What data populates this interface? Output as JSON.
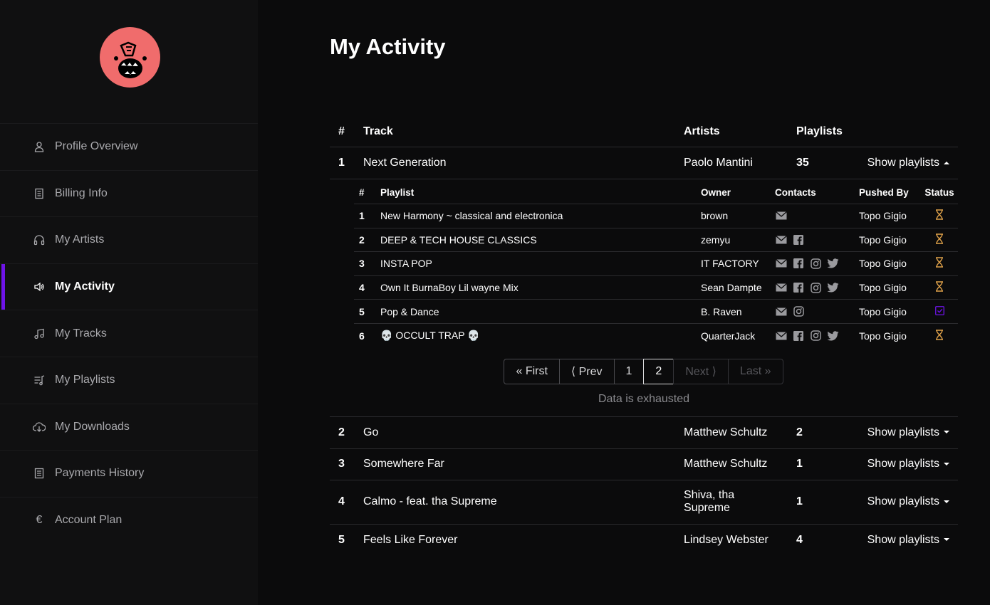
{
  "sidebar": {
    "items": [
      {
        "label": "Profile Overview",
        "icon": "user-icon"
      },
      {
        "label": "Billing Info",
        "icon": "document-icon"
      },
      {
        "label": "My Artists",
        "icon": "headphones-icon"
      },
      {
        "label": "My Activity",
        "icon": "speaker-icon",
        "active": true
      },
      {
        "label": "My Tracks",
        "icon": "music-note-icon"
      },
      {
        "label": "My Playlists",
        "icon": "playlist-icon"
      },
      {
        "label": "My Downloads",
        "icon": "cloud-download-icon"
      },
      {
        "label": "Payments History",
        "icon": "receipt-icon"
      },
      {
        "label": "Account Plan",
        "icon": "euro-icon"
      }
    ]
  },
  "page": {
    "title": "My Activity"
  },
  "table": {
    "headers": {
      "num": "#",
      "track": "Track",
      "artists": "Artists",
      "playlists": "Playlists"
    },
    "show_label": "Show playlists",
    "rows": [
      {
        "num": "1",
        "track": "Next Generation",
        "artist": "Paolo Mantini",
        "playlists": "35"
      },
      {
        "num": "2",
        "track": "Go",
        "artist": "Matthew Schultz",
        "playlists": "2"
      },
      {
        "num": "3",
        "track": "Somewhere Far",
        "artist": "Matthew Schultz",
        "playlists": "1"
      },
      {
        "num": "4",
        "track": "Calmo - feat. tha Supreme",
        "artist": "Shiva, tha Supreme",
        "playlists": "1"
      },
      {
        "num": "5",
        "track": "Feels Like Forever",
        "artist": "Lindsey Webster",
        "playlists": "4"
      }
    ]
  },
  "subtable": {
    "headers": {
      "num": "#",
      "playlist": "Playlist",
      "owner": "Owner",
      "contacts": "Contacts",
      "pushed_by": "Pushed By",
      "status": "Status"
    },
    "rows": [
      {
        "num": "1",
        "playlist": "New Harmony ~ classical and electronica",
        "owner": "brown",
        "pushed_by": "Topo Gigio"
      },
      {
        "num": "2",
        "playlist": "DEEP & TECH HOUSE CLASSICS",
        "owner": "zemyu",
        "pushed_by": "Topo Gigio"
      },
      {
        "num": "3",
        "playlist": "INSTA POP",
        "owner": "IT FACTORY",
        "pushed_by": "Topo Gigio"
      },
      {
        "num": "4",
        "playlist": "Own It BurnaBoy Lil wayne Mix",
        "owner": "Sean Dampte",
        "pushed_by": "Topo Gigio"
      },
      {
        "num": "5",
        "playlist": "Pop & Dance",
        "owner": "B. Raven",
        "pushed_by": "Topo Gigio"
      },
      {
        "num": "6",
        "playlist": "💀 OCCULT TRAP 💀",
        "owner": "QuarterJack",
        "pushed_by": "Topo Gigio"
      }
    ]
  },
  "pagination": {
    "first": "« First",
    "prev": "⟨ Prev",
    "page1": "1",
    "page2": "2",
    "next": "Next ⟩",
    "last": "Last »",
    "status": "Data is exhausted"
  },
  "colors": {
    "accent": "#6e13e8",
    "pending": "#e0a24a",
    "logo": "#f06c6c"
  }
}
